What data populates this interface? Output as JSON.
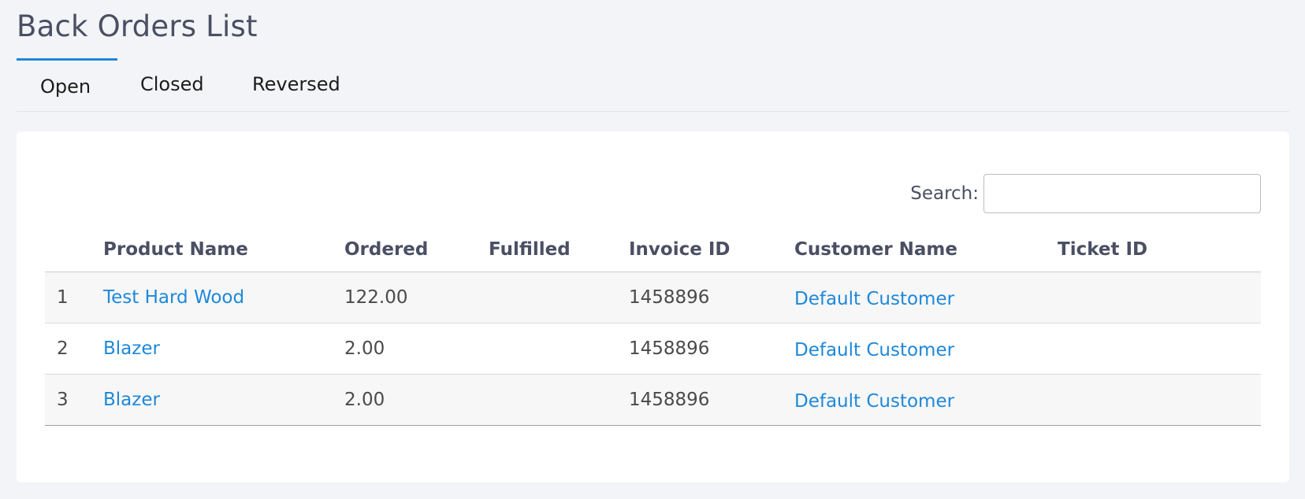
{
  "page": {
    "title": "Back Orders List"
  },
  "tabs": [
    {
      "label": "Open",
      "active": true
    },
    {
      "label": "Closed",
      "active": false
    },
    {
      "label": "Reversed",
      "active": false
    }
  ],
  "search": {
    "label": "Search:",
    "value": "",
    "placeholder": ""
  },
  "table": {
    "headers": {
      "index": "",
      "product_name": "Product Name",
      "ordered": "Ordered",
      "fulfilled": "Fulfilled",
      "invoice_id": "Invoice ID",
      "customer_name": "Customer Name",
      "ticket_id": "Ticket ID"
    },
    "rows": [
      {
        "index": "1",
        "product_name": "Test Hard Wood",
        "ordered": "122.00",
        "fulfilled": "",
        "invoice_id": "1458896",
        "customer_name": "Default Customer",
        "ticket_id": ""
      },
      {
        "index": "2",
        "product_name": "Blazer",
        "ordered": "2.00",
        "fulfilled": "",
        "invoice_id": "1458896",
        "customer_name": "Default Customer",
        "ticket_id": ""
      },
      {
        "index": "3",
        "product_name": "Blazer",
        "ordered": "2.00",
        "fulfilled": "",
        "invoice_id": "1458896",
        "customer_name": "Default Customer",
        "ticket_id": ""
      }
    ]
  },
  "colors": {
    "accent": "#1e88d8",
    "background": "#f3f4f7",
    "card": "#ffffff"
  }
}
